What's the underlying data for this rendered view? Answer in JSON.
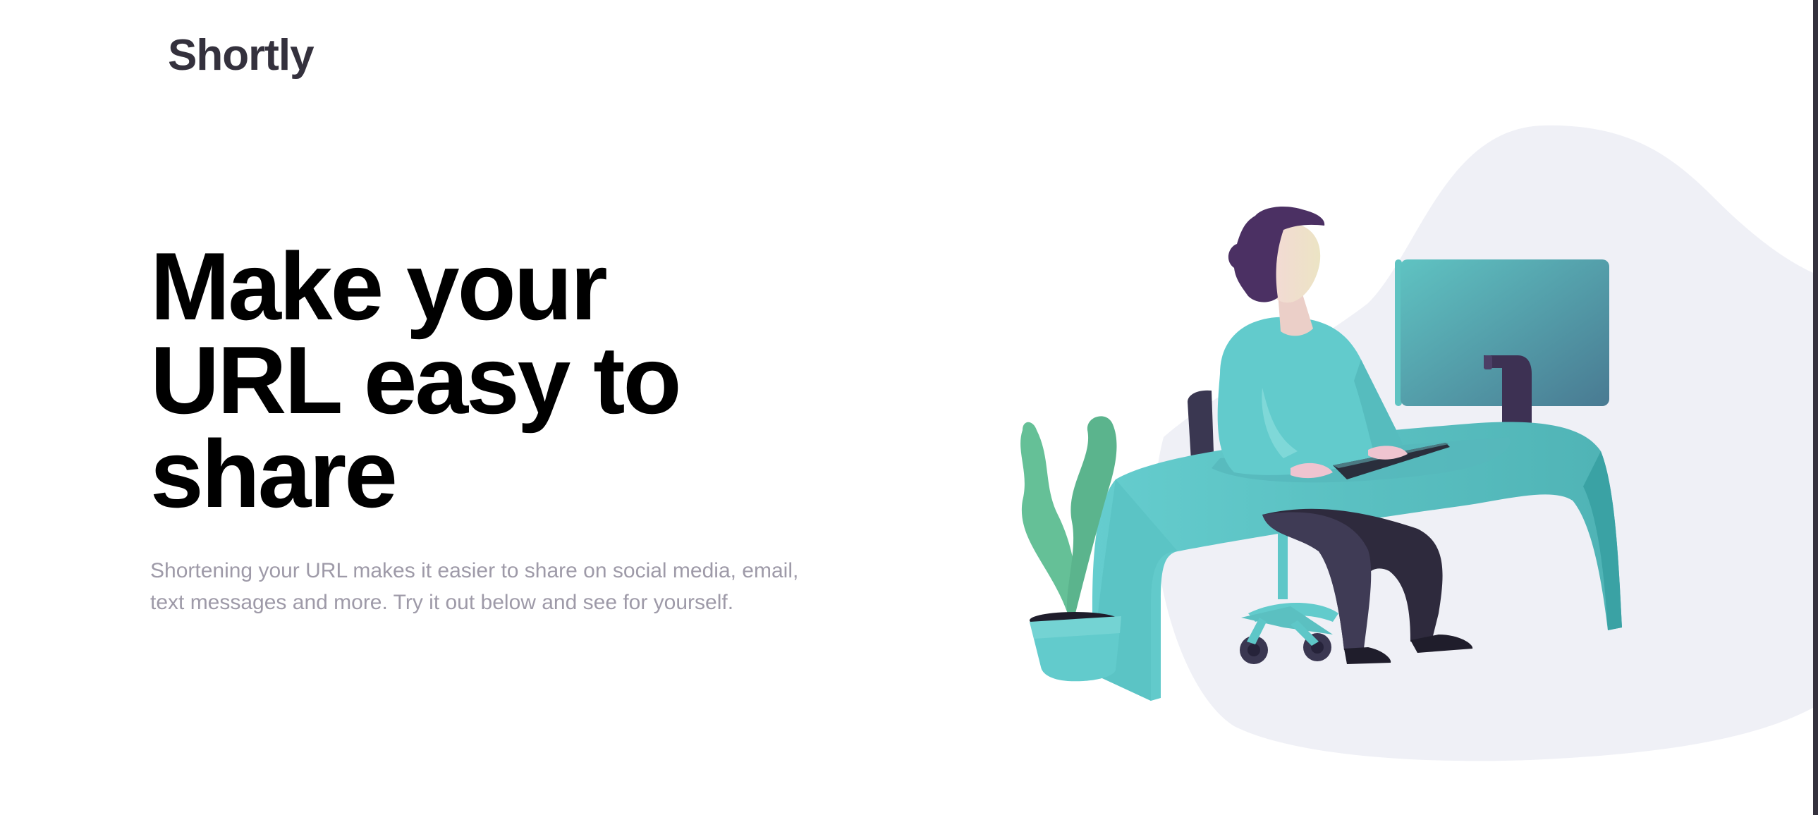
{
  "header": {
    "logo_text": "Shortly"
  },
  "hero": {
    "title": "Make your URL easy to share",
    "subtitle": "Shortening your URL makes it easier to share on social media, email, text messages and more. Try it out below and see for yourself."
  },
  "illustration": {
    "icon": "person-working-at-desk-illustration"
  },
  "colors": {
    "logo": "#34313d",
    "title": "#000000",
    "subtitle": "#9e9aa8",
    "blob": "#eff0f6",
    "desk": "#62cbcc",
    "plant": "#65c097",
    "hair": "#4b3063",
    "pants": "#2e2a3d"
  }
}
